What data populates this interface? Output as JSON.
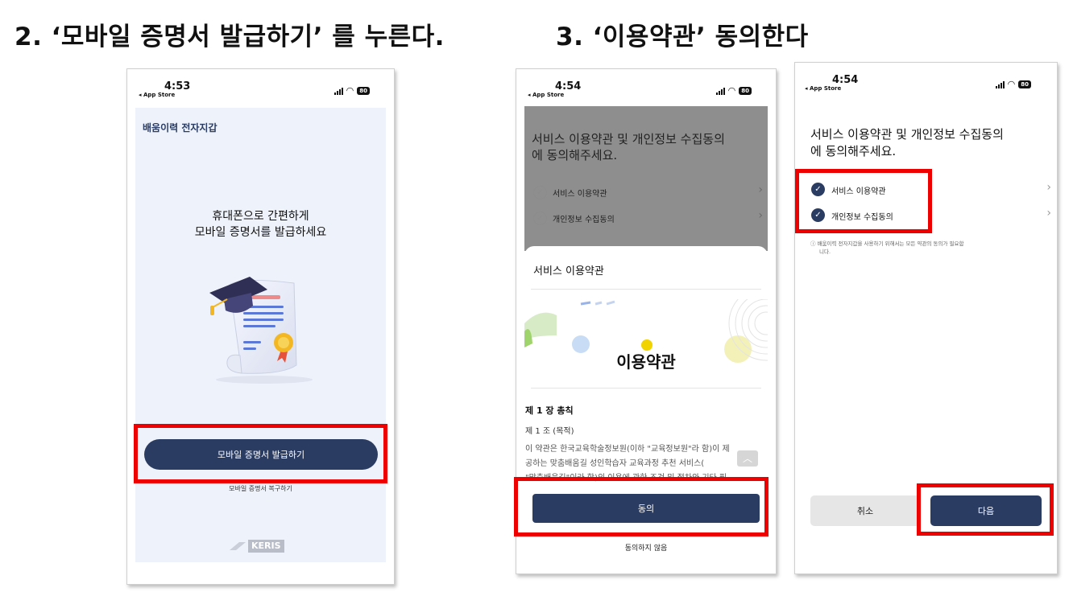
{
  "headings": {
    "step2": "2. ‘모바일 증명서 발급하기’ 를 누른다.",
    "step3": "3. ‘이용약관’ 동의한다"
  },
  "statusbar": {
    "back_label": "◂ App Store",
    "battery": "80"
  },
  "screen1": {
    "time": "4:53",
    "app_title": "배움이력 전자지갑",
    "hero_line1": "휴대폰으로 간편하게",
    "hero_line2": "모바일 증명서를 발급하세요",
    "issue_button": "모바일 증명서 발급하기",
    "restore_link": "모바일 증명서 복구하기",
    "footer_logo": "KERIS"
  },
  "screen2": {
    "time": "4:54",
    "consent_title_line1": "서비스 이용약관 및 개인정보 수집동의",
    "consent_title_line2": "에 동의해주세요.",
    "consent_items": [
      "서비스 이용약관",
      "개인정보 수집동의"
    ],
    "sheet_title": "서비스 이용약관",
    "banner_title": "이용약관",
    "chapter": "제 1 장 총칙",
    "article": "제 1 조 (목적)",
    "body_lines": [
      "이 약관은 한국교육학술정보원(이하 \"교육정보원\"라 함)이 제",
      "공하는 맞춤배움길 성인학습자 교육과정 추천 서비스(",
      "\"맞춤배움길\"이라 함)의 이용에 관한 조건 및 절차와 기타 필"
    ],
    "agree_button": "동의",
    "disagree_link": "동의하지 않음"
  },
  "screen3": {
    "time": "4:54",
    "consent_title_line1": "서비스 이용약관 및 개인정보 수집동의",
    "consent_title_line2": "에 동의해주세요.",
    "consent_items": [
      "서비스 이용약관",
      "개인정보 수집동의"
    ],
    "notice_line1": "ⓘ 배움이력 전자지갑을 사용하기 위해서는 모든 약관의 동의가 필요합",
    "notice_line2": "니다.",
    "cancel_button": "취소",
    "next_button": "다음"
  },
  "colors": {
    "navy": "#2b3c63",
    "highlight_red": "#ee0000",
    "screen1_bg": "#eef3fb"
  }
}
